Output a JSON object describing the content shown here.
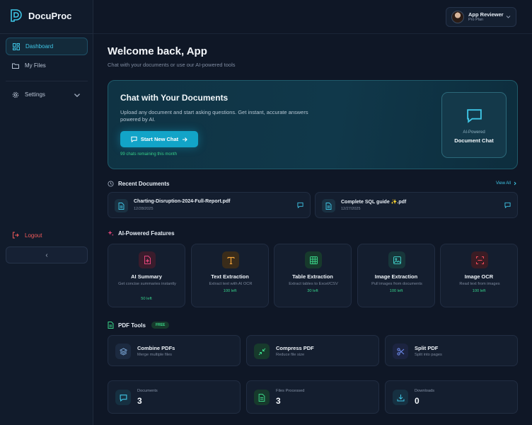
{
  "brand": {
    "name": "DocuProc"
  },
  "sidebar": {
    "items": [
      {
        "label": "Dashboard",
        "icon": "dashboard-icon",
        "active": true
      },
      {
        "label": "My Files",
        "icon": "folder-icon",
        "active": false
      },
      {
        "label": "Settings",
        "icon": "gear-icon",
        "active": false
      }
    ],
    "logout_label": "Logout",
    "collapse_glyph": "‹"
  },
  "user": {
    "name": "App Reviewer",
    "plan": "Pro Plan"
  },
  "welcome": {
    "title": "Welcome back, App",
    "subtitle": "Chat with your documents or use our AI-powered tools"
  },
  "hero": {
    "title": "Chat with Your Documents",
    "description": "Upload any document and start asking questions. Get instant, accurate answers powered by AI.",
    "button_label": "Start New Chat",
    "remaining": "99 chats remaining this month",
    "card_kicker": "AI-Powered",
    "card_title": "Document Chat"
  },
  "recent": {
    "title": "Recent Documents",
    "view_all": "View All",
    "docs": [
      {
        "name": "Charting-Disruption-2024-Full-Report.pdf",
        "date": "12/28/2025"
      },
      {
        "name": "Complete SQL guide ✨.pdf",
        "date": "12/27/2025"
      }
    ]
  },
  "features": {
    "title": "AI-Powered Features",
    "items": [
      {
        "title": "AI Summary",
        "desc": "Get concise summaries instantly",
        "left": "50 left",
        "icon": "document-sparkle-icon",
        "color": "#e0457b",
        "bg": "#3a1c2c"
      },
      {
        "title": "Text Extraction",
        "desc": "Extract text with AI OCR",
        "left": "100 left",
        "icon": "text-t-icon",
        "color": "#f2a33a",
        "bg": "#3a2c1a"
      },
      {
        "title": "Table Extraction",
        "desc": "Extract tables to Excel/CSV",
        "left": "30 left",
        "icon": "table-icon",
        "color": "#3ad488",
        "bg": "#173a2c"
      },
      {
        "title": "Image Extraction",
        "desc": "Pull images from documents",
        "left": "100 left",
        "icon": "image-icon",
        "color": "#3fc6c0",
        "bg": "#17363a"
      },
      {
        "title": "Image OCR",
        "desc": "Read text from images",
        "left": "100 left",
        "icon": "scan-icon",
        "color": "#ef4a5a",
        "bg": "#3a1c24"
      }
    ]
  },
  "pdf_tools": {
    "title": "PDF Tools",
    "badge": "FREE",
    "items": [
      {
        "title": "Combine PDFs",
        "desc": "Merge multiple files",
        "icon": "layers-icon",
        "color": "#7aa6d6",
        "bg": "#1c2a40"
      },
      {
        "title": "Compress PDF",
        "desc": "Reduce file size",
        "icon": "compress-arrows-icon",
        "color": "#3ad488",
        "bg": "#173a2c"
      },
      {
        "title": "Split PDF",
        "desc": "Split into pages",
        "icon": "scissors-icon",
        "color": "#6f8ef0",
        "bg": "#1c2440"
      }
    ]
  },
  "stats": [
    {
      "label": "Documents",
      "value": "3",
      "icon": "chat-bubble-icon",
      "color": "#3fc6e6",
      "bg": "#163041"
    },
    {
      "label": "Files Processed",
      "value": "3",
      "icon": "file-text-icon",
      "color": "#3ad488",
      "bg": "#173a2c"
    },
    {
      "label": "Downloads",
      "value": "0",
      "icon": "download-icon",
      "color": "#3fc6e6",
      "bg": "#163041"
    }
  ]
}
